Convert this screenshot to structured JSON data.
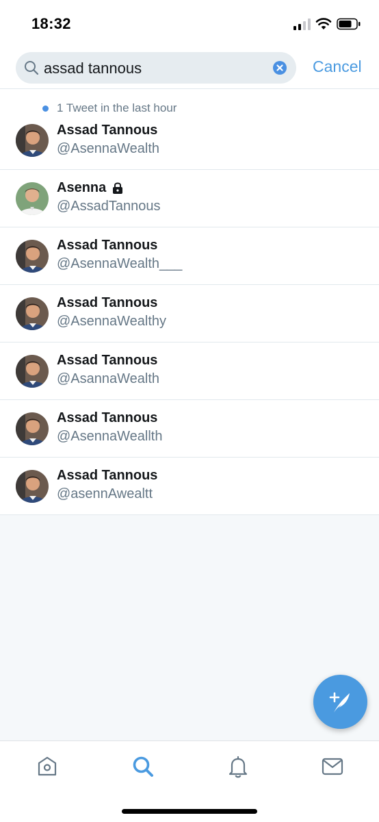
{
  "status_bar": {
    "time": "18:32",
    "icons": [
      "cellular-signal-icon",
      "wifi-icon",
      "battery-icon"
    ]
  },
  "search": {
    "query": "assad tannous",
    "cancel_label": "Cancel",
    "icons": [
      "search-icon",
      "clear-icon"
    ]
  },
  "recent_note": "1 Tweet in the last hour",
  "results": [
    {
      "name": "Assad Tannous",
      "handle": "@AsennaWealth",
      "protected": false
    },
    {
      "name": "Asenna",
      "handle": "@AssadTannous",
      "protected": true
    },
    {
      "name": "Assad Tannous",
      "handle": "@AsennaWealth___",
      "protected": false
    },
    {
      "name": "Assad Tannous",
      "handle": "@AsennaWealthy",
      "protected": false
    },
    {
      "name": "Assad Tannous",
      "handle": "@AsannaWealth",
      "protected": false
    },
    {
      "name": "Assad Tannous",
      "handle": "@AsennaWeallth",
      "protected": false
    },
    {
      "name": "Assad Tannous",
      "handle": "@asennAwealtt",
      "protected": false
    }
  ],
  "compose": {
    "icon": "compose-tweet-icon"
  },
  "tab_bar": {
    "tabs": [
      {
        "icon": "home-icon",
        "active": false
      },
      {
        "icon": "search-icon",
        "active": true
      },
      {
        "icon": "notifications-bell-icon",
        "active": false
      },
      {
        "icon": "messages-envelope-icon",
        "active": false
      }
    ]
  },
  "colors": {
    "accent": "#4a9ae0",
    "text_primary": "#14171a",
    "text_secondary": "#657786",
    "background": "#f5f8fa",
    "divider": "#e1e8ed"
  }
}
